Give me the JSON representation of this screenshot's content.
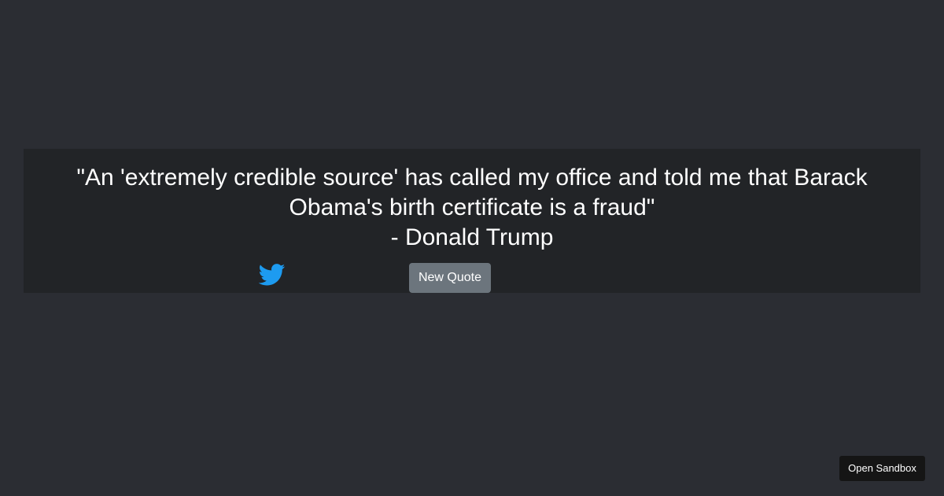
{
  "quote": {
    "text": "\"An 'extremely credible source' has called my office and told me that Barack Obama's birth certificate is a fraud\"",
    "author": "- Donald Trump"
  },
  "actions": {
    "tweet_icon": "twitter-bird-icon",
    "tweet_color": "#1d9bf0",
    "new_quote_label": "New Quote"
  },
  "sandbox": {
    "open_label": "Open Sandbox"
  },
  "colors": {
    "background": "#2b2d33",
    "quote_box": "#222427",
    "button": "#6c757d"
  }
}
